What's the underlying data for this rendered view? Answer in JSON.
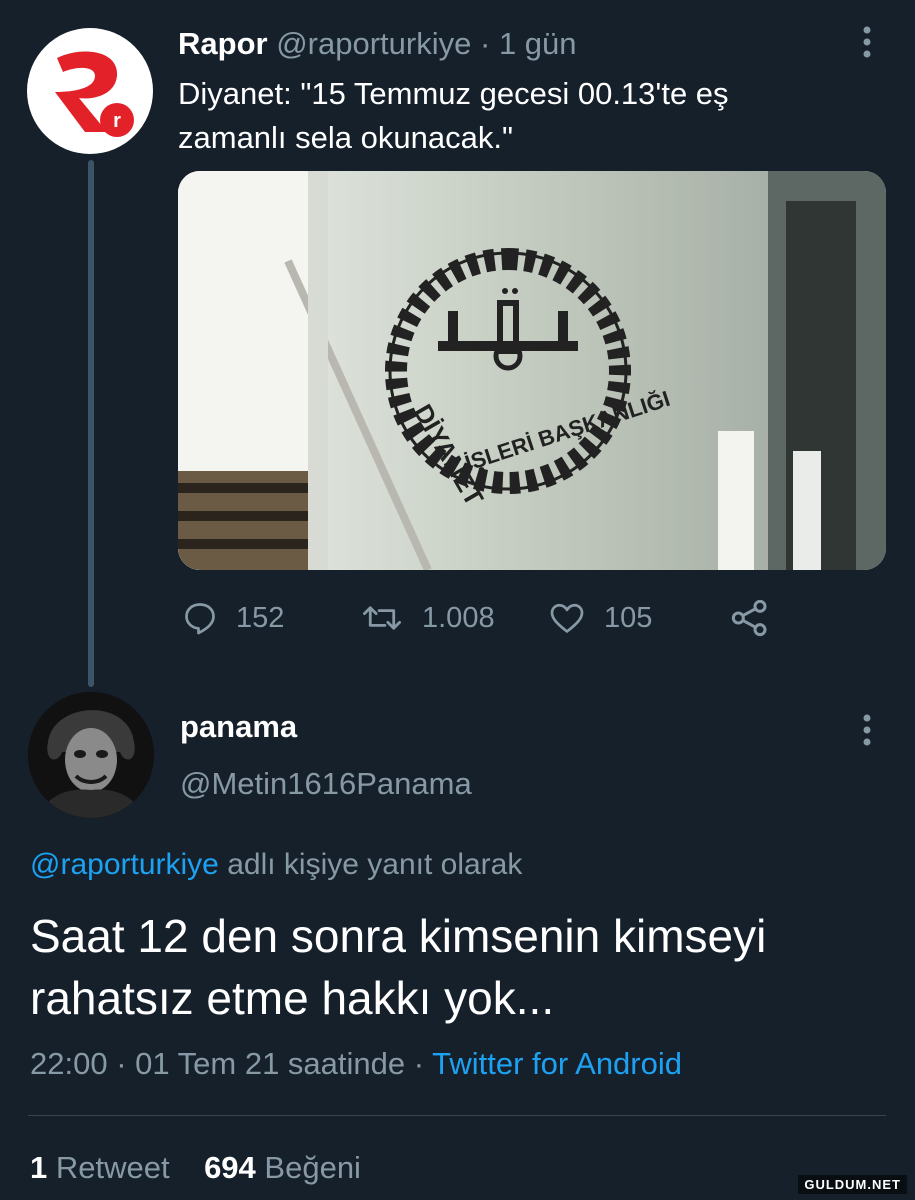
{
  "tweet1": {
    "display_name": "Rapor",
    "handle": "@raporturkiye",
    "separator": "·",
    "time": "1 gün",
    "text": "Diyanet: \"15 Temmuz gecesi 00.13'te eş zamanlı sela okunacak.\"",
    "media_text_top": "DİYANET",
    "media_text_bottom": "İŞLERİ BAŞKANLIĞI",
    "actions": {
      "replies": "152",
      "retweets": "1.008",
      "likes": "105"
    },
    "avatar_letter": "r"
  },
  "tweet2": {
    "display_name": "panama",
    "handle": "@Metin1616Panama",
    "reply_to_handle": "@raporturkiye",
    "reply_to_suffix": "adlı kişiye yanıt olarak",
    "text": "Saat 12 den sonra kimsenin kimseyi rahatsız etme hakkı yok...",
    "timestamp": "22:00 · 01 Tem 21 saatinde",
    "separator": "·",
    "client": "Twitter for Android",
    "retweet_count": "1",
    "retweet_label": "Retweet",
    "like_count": "694",
    "like_label": "Beğeni"
  },
  "watermark": "GULDUM.NET",
  "colors": {
    "background": "#15202b",
    "text": "#ffffff",
    "muted": "#8899a6",
    "link": "#1da1f2",
    "avatar_brand": "#e32128"
  },
  "icons": [
    "more-vertical-icon",
    "reply-icon",
    "retweet-icon",
    "like-icon",
    "share-icon"
  ]
}
